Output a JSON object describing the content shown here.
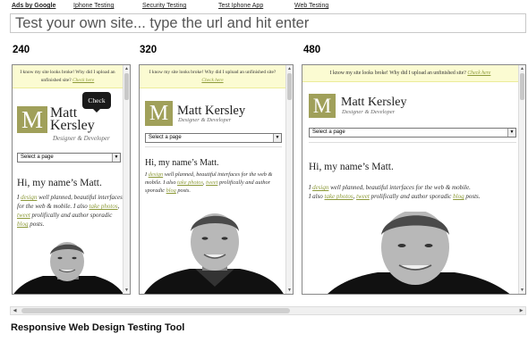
{
  "nav": {
    "items": [
      "Ads by Google",
      "Iphone Testing",
      "Security Testing",
      "Test Iphone App",
      "Web Testing"
    ]
  },
  "url_input": {
    "placeholder": "Test your own site... type the url and hit enter"
  },
  "frames": [
    {
      "width_label": "240"
    },
    {
      "width_label": "320"
    },
    {
      "width_label": "480"
    }
  ],
  "site": {
    "notice_text": "I know my site looks broke! Why did I upload an unfinished site?",
    "notice_link": "Check here",
    "logo_letter": "M",
    "name_first": "Matt",
    "name_last": "Kersley",
    "name_full": "Matt Kersley",
    "tagline": "Designer & Developer",
    "select_value": "Select a page",
    "greeting": "Hi, my name’s Matt.",
    "intro": {
      "p1": "I",
      "design": "design",
      "p2": "well planned, beautiful interfaces for the web & mobile.",
      "p3": "I also",
      "photos": "take photos",
      "tweet": "tweet",
      "p4": "prolifically and author sporadic",
      "blog": "blog",
      "p5": "posts."
    }
  },
  "tooltip": {
    "text": "Check"
  },
  "footer": {
    "title": "Responsive Web Design Testing Tool"
  }
}
